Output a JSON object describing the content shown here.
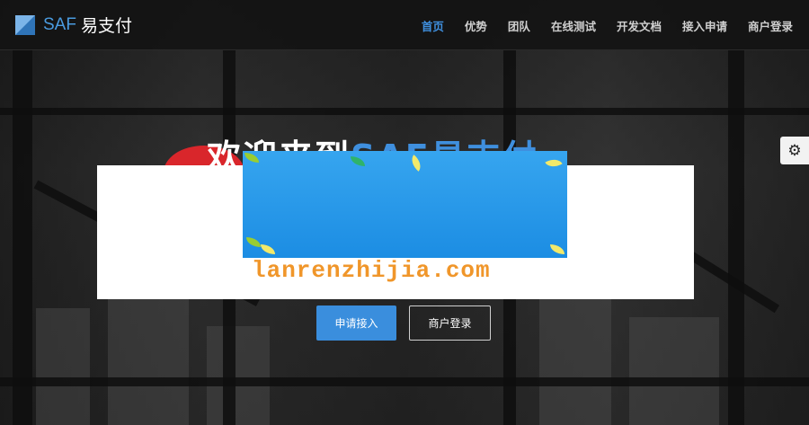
{
  "brand": {
    "saf": "SAF",
    "cn": "易支付"
  },
  "nav": [
    {
      "label": "首页",
      "active": true
    },
    {
      "label": "优势",
      "active": false
    },
    {
      "label": "团队",
      "active": false
    },
    {
      "label": "在线测试",
      "active": false
    },
    {
      "label": "开发文档",
      "active": false
    },
    {
      "label": "接入申请",
      "active": false
    },
    {
      "label": "商户登录",
      "active": false
    }
  ],
  "hero": {
    "headline_prefix": "欢迎来到",
    "headline_brand": "SAF易支付",
    "apply_button": "申请接入",
    "login_button": "商户登录"
  },
  "overlay": {
    "watermark": "lanrenzhijia.com"
  },
  "icons": {
    "settings": "gear-icon",
    "logo": "brand-logo-icon"
  },
  "colors": {
    "accent": "#3f8fde",
    "nav_bg": "#141414",
    "watermark": "#f0962a",
    "ad_blue": "#2a98ea"
  }
}
